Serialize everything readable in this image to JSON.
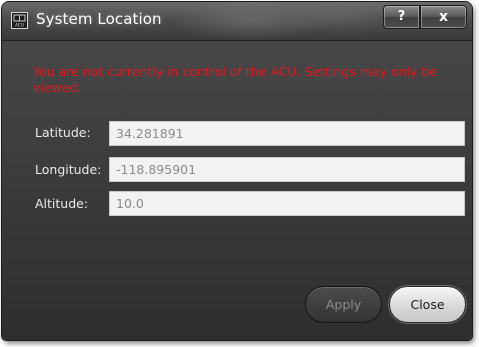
{
  "window": {
    "title": "System Location",
    "icon": "acu-app-icon",
    "icon_text": "ACU"
  },
  "titlebar_buttons": {
    "help_label": "?",
    "close_label": "x"
  },
  "warning_message": "You are not currently in control of the ACU. Settings may only be viewed.",
  "fields": {
    "latitude": {
      "label": "Latitude:",
      "value": "34.281891"
    },
    "longitude": {
      "label": "Longitude:",
      "value": "-118.895901"
    },
    "altitude": {
      "label": "Altitude:",
      "value": "10.0"
    }
  },
  "buttons": {
    "apply_label": "Apply",
    "close_label": "Close"
  },
  "colors": {
    "window_background": "#2e2e2e",
    "warning_text": "#e8161b",
    "label_text": "#ebebeb",
    "input_value_text": "#8a8a8a"
  }
}
